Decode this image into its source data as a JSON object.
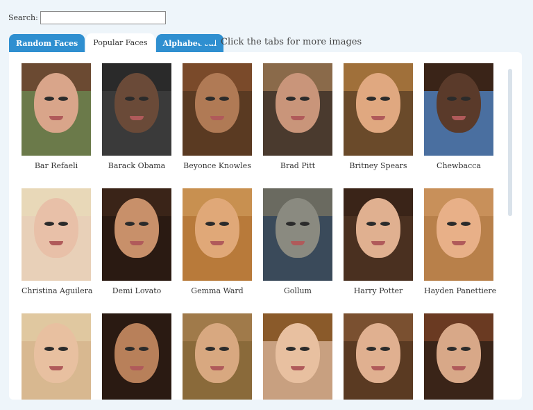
{
  "search": {
    "label": "Search:",
    "value": "",
    "placeholder": ""
  },
  "tabs": [
    {
      "label": "Random Faces",
      "active": false
    },
    {
      "label": "Popular Faces",
      "active": true
    },
    {
      "label": "Alphabetical",
      "active": false
    }
  ],
  "hint": {
    "text": "Click the tabs for more images",
    "icon": "arrow-left-icon"
  },
  "faces": [
    {
      "name": "Bar Refaeli",
      "skin": "#d9a58a",
      "hair": "#6b4a32",
      "bg": "#6b7a4a"
    },
    {
      "name": "Barack Obama",
      "skin": "#6a4a38",
      "hair": "#2a2a2a",
      "bg": "#3a3a3a"
    },
    {
      "name": "Beyonce Knowles",
      "skin": "#b07a55",
      "hair": "#7a4a2a",
      "bg": "#5a3a22"
    },
    {
      "name": "Brad Pitt",
      "skin": "#c9957a",
      "hair": "#8a6a4a",
      "bg": "#4a3a2e"
    },
    {
      "name": "Britney Spears",
      "skin": "#e0a880",
      "hair": "#a0703a",
      "bg": "#6a4a2a"
    },
    {
      "name": "Chewbacca",
      "skin": "#5a3a2a",
      "hair": "#3a2418",
      "bg": "#4a6fa0"
    },
    {
      "name": "Christina Aguilera",
      "skin": "#e8c0a8",
      "hair": "#e8d8b8",
      "bg": "#e8d0b8"
    },
    {
      "name": "Demi Lovato",
      "skin": "#c8906a",
      "hair": "#3a2418",
      "bg": "#2a1a12"
    },
    {
      "name": "Gemma Ward",
      "skin": "#e0a878",
      "hair": "#c89050",
      "bg": "#b87a3a"
    },
    {
      "name": "Gollum",
      "skin": "#8a8a80",
      "hair": "#6a6a60",
      "bg": "#3a4a5a"
    },
    {
      "name": "Harry Potter",
      "skin": "#e0b090",
      "hair": "#3a2418",
      "bg": "#4a3020"
    },
    {
      "name": "Hayden Panettiere",
      "skin": "#e8b088",
      "hair": "#c8905a",
      "bg": "#b8804a"
    },
    {
      "name": "",
      "skin": "#e8c0a0",
      "hair": "#e0c8a0",
      "bg": "#d8b890"
    },
    {
      "name": "",
      "skin": "#b8805a",
      "hair": "#2a1a12",
      "bg": "#2a1a12"
    },
    {
      "name": "",
      "skin": "#d8a880",
      "hair": "#a07a4a",
      "bg": "#8a6a3a"
    },
    {
      "name": "",
      "skin": "#e8c0a0",
      "hair": "#8a5a2a",
      "bg": "#c8a080"
    },
    {
      "name": "",
      "skin": "#e0b090",
      "hair": "#7a5030",
      "bg": "#5a3a22"
    },
    {
      "name": "",
      "skin": "#d8a888",
      "hair": "#6a3a22",
      "bg": "#3a2418"
    }
  ]
}
